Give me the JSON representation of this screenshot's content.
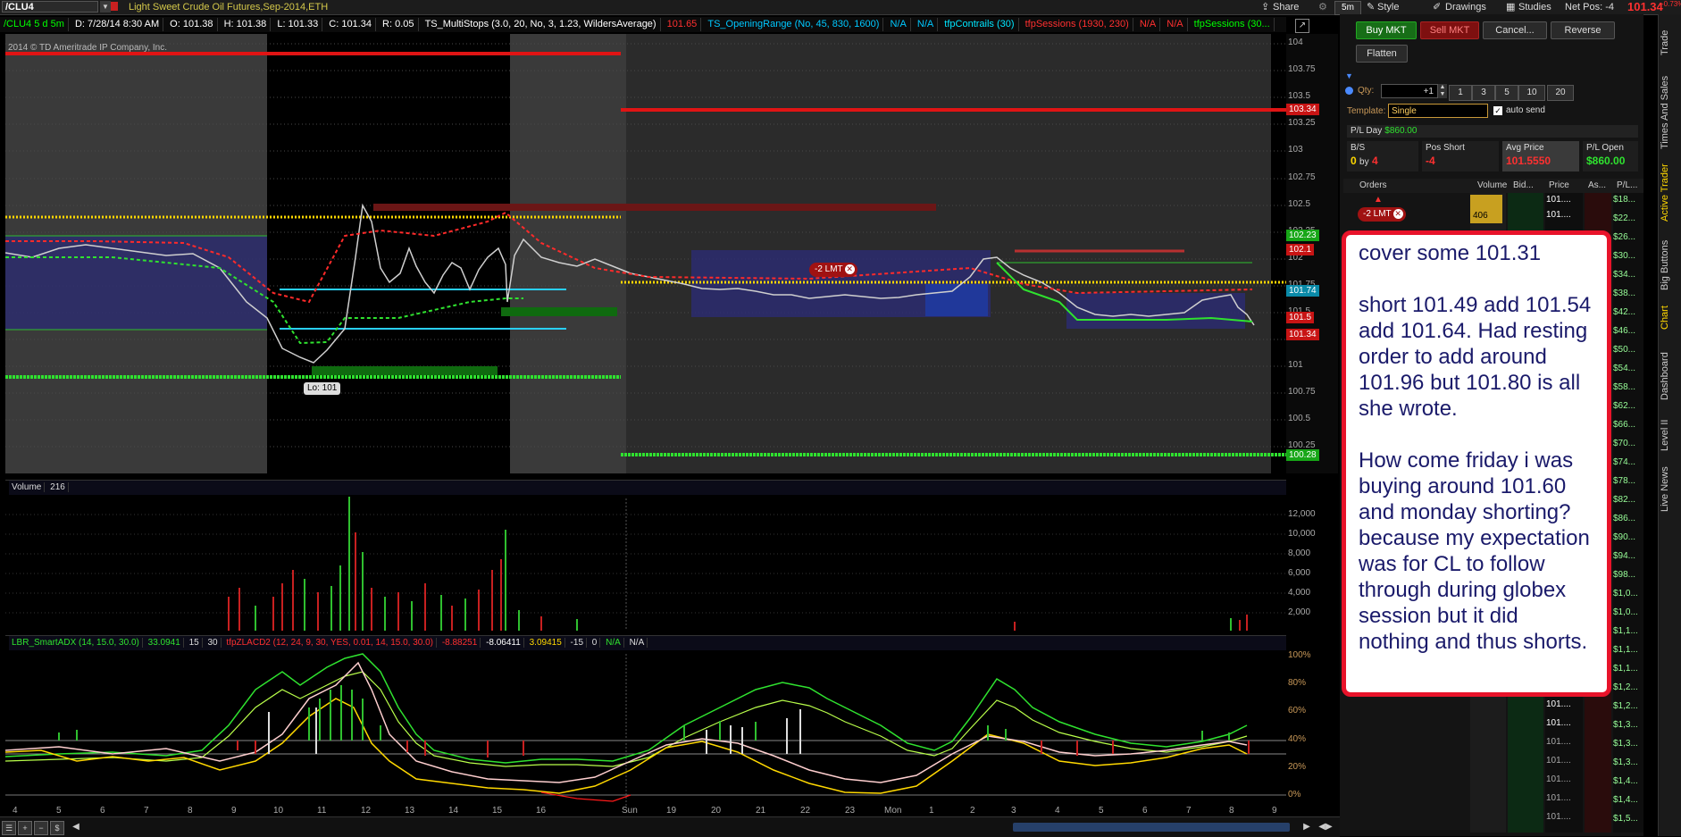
{
  "header": {
    "symbol": "/CLU4",
    "description": "Light Sweet Crude Oil Futures,Sep-2014,ETH",
    "share": "Share",
    "style": "Style",
    "drawings": "Drawings",
    "studies": "Studies",
    "timeframe": "5m",
    "net_pos_label": "Net Pos: -4",
    "last_price": "101.34",
    "net_change": "-0.73%"
  },
  "quotes": {
    "sym": "/CLU4 5 d 5m",
    "date": "D: 7/28/14 8:30 AM",
    "open": "O: 101.38",
    "high": "H: 101.38",
    "low": "L: 101.33",
    "close": "C: 101.34",
    "range": "R: 0.05",
    "study1": "TS_MultiStops (3.0, 20, No, 3, 1.23, WildersAverage)",
    "study1_val": "101.65",
    "study2": "TS_OpeningRange (No, 45, 830, 1600)",
    "na1": "N/A",
    "na2": "N/A",
    "study3": "tfpContrails (30)",
    "study4": "tfpSessions (1930, 230)",
    "na3": "N/A",
    "na4": "N/A",
    "study5": "tfpSessions (30..."
  },
  "chart": {
    "copyright": "2014 © TD Ameritrade IP Company, Inc.",
    "low_label": "Lo: 101",
    "order_label": "-2 LMT",
    "price_ticks": [
      "104",
      "103.75",
      "103.5",
      "103.25",
      "103",
      "102.75",
      "102.5",
      "102.25",
      "102",
      "101.75",
      "101.5",
      "101.25",
      "101",
      "100.75",
      "100.5",
      "100.25"
    ],
    "price_tags": [
      {
        "text": "103.34",
        "color": "#c81414"
      },
      {
        "text": "102.23",
        "color": "#17a617"
      },
      {
        "text": "102.1",
        "color": "#c81414"
      },
      {
        "text": "101.74",
        "color": "#0a8aa8"
      },
      {
        "text": "101.5",
        "color": "#c81414"
      },
      {
        "text": "101.34",
        "color": "#c81414"
      },
      {
        "text": "100.28",
        "color": "#17a617"
      }
    ],
    "time_ticks": [
      "4",
      "5",
      "6",
      "7",
      "8",
      "9",
      "10",
      "11",
      "12",
      "13",
      "14",
      "15",
      "16",
      "Sun",
      "19",
      "20",
      "21",
      "22",
      "23",
      "Mon",
      "1",
      "2",
      "3",
      "4",
      "5",
      "6",
      "7",
      "8",
      "9"
    ]
  },
  "volume": {
    "label": "Volume",
    "value": "216",
    "ticks": [
      "12,000",
      "10,000",
      "8,000",
      "6,000",
      "4,000",
      "2,000"
    ]
  },
  "lower": {
    "study1": "LBR_SmartADX (14, 15.0, 30.0)",
    "v1": "33.0941",
    "v2": "15",
    "v3": "30",
    "study2": "tfpZLACD2 (12, 24, 9, 30, YES, 0.01, 14, 15.0, 30.0)",
    "v4": "-8.88251",
    "v5": "-8.06411",
    "v6": "3.09415",
    "v7": "-15",
    "v8": "0",
    "na1": "N/A",
    "na2": "N/A",
    "ticks": [
      "100%",
      "80%",
      "60%",
      "40%",
      "20%",
      "0%"
    ]
  },
  "trader": {
    "buy_mkt": "Buy MKT",
    "sell_mkt": "Sell MKT",
    "cancel": "Cancel...",
    "reverse": "Reverse",
    "flatten": "Flatten",
    "qty_label": "Qty:",
    "qty_value": "+1",
    "qty_options": [
      "1",
      "3",
      "5",
      "10",
      "20"
    ],
    "template_label": "Template:",
    "template_value": "Single",
    "auto_send": "auto send",
    "pl_day_label": "P/L Day",
    "pl_day_value": "$860.00",
    "bs_label": "B/S",
    "bs_value_a": "0",
    "bs_by": "by",
    "bs_value_b": "4",
    "pos_label": "Pos Short",
    "pos_value": "-4",
    "avg_label": "Avg Price",
    "avg_value": "101.5550",
    "plopen_label": "P/L Open",
    "plopen_value": "$860.00",
    "cols": [
      "Orders",
      "Volume",
      "Bid...",
      "Price",
      "As...",
      "P/L..."
    ],
    "order_badge": "-2 LMT",
    "vol_first": "406",
    "price_rows": [
      "101....",
      "101....",
      "101....",
      "101....",
      "101....",
      "101....",
      "101....",
      "101....",
      "101....",
      "101....",
      "101....",
      "101....",
      "101....",
      "101....",
      "101....",
      "101....",
      "101....",
      "101....",
      "101....",
      "101....",
      "101....",
      "101....",
      "101....",
      "101....",
      "101....",
      "101....",
      "101....",
      "101....",
      "101....",
      "101....",
      "101....",
      "101....",
      "101....",
      "101....",
      "101....",
      "101...."
    ],
    "pl_rows": [
      "$18...",
      "$22...",
      "$26...",
      "$30...",
      "$34...",
      "$38...",
      "$42...",
      "$46...",
      "$50...",
      "$54...",
      "$58...",
      "$62...",
      "$66...",
      "$70...",
      "$74...",
      "$78...",
      "$82...",
      "$86...",
      "$90...",
      "$94...",
      "$98...",
      "$1,0...",
      "$1,0...",
      "$1,1...",
      "$1,1...",
      "$1,1...",
      "$1,2...",
      "$1,2...",
      "$1,3...",
      "$1,3...",
      "$1,3...",
      "$1,4...",
      "$1,4...",
      "$1,5...",
      "$1,5..."
    ]
  },
  "vertical_tabs": [
    "Trade",
    "Times And Sales",
    "Active Trader",
    "Big Buttons",
    "Chart",
    "Dashboard",
    "Level II",
    "Live News"
  ],
  "note": {
    "p1": "cover some 101.31",
    "p2": "short 101.49 add 101.54 add 101.64. Had resting order to add around 101.96 but 101.80 is all she wrote.",
    "p3": "How come friday i was buying around 101.60 and monday shorting? because my expectation was for CL to follow through during globex session but it did nothing and thus shorts."
  }
}
